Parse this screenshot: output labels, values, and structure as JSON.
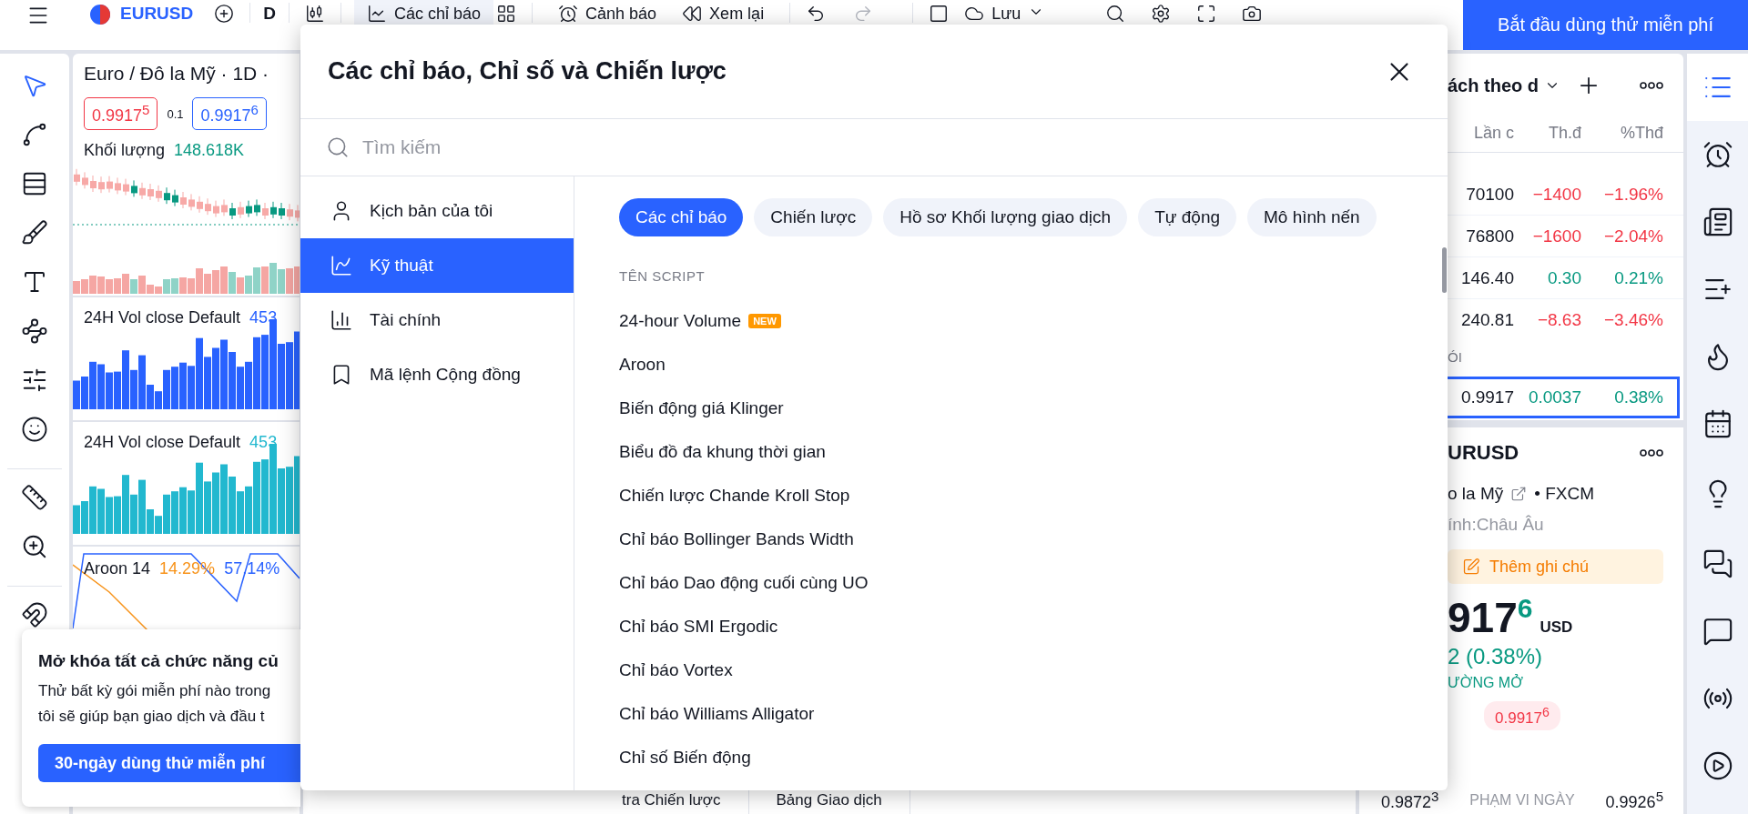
{
  "toolbar": {
    "symbol": "EURUSD",
    "interval": "D",
    "buttons": [
      {
        "kind": "indicators",
        "label": "Các chỉ báo",
        "selected": true
      },
      {
        "kind": "alert",
        "label": "Cảnh báo",
        "selected": false
      },
      {
        "kind": "replay",
        "label": "Xem lại",
        "selected": false
      }
    ],
    "redo_disabled": true,
    "save_label": "Lưu",
    "cta": "Bắt đầu dùng thử miễn phí"
  },
  "drawing_tools": [
    {
      "kind": "cursor",
      "selected": true
    },
    {
      "kind": "trend-line",
      "selected": false
    },
    {
      "kind": "fib",
      "selected": false
    },
    {
      "kind": "brush",
      "selected": false
    },
    {
      "kind": "text",
      "selected": false
    },
    {
      "kind": "pattern",
      "selected": false
    },
    {
      "kind": "forecast",
      "selected": false
    },
    {
      "kind": "emoji",
      "selected": false
    },
    {
      "kind": "ruler",
      "selected": false
    },
    {
      "kind": "zoom",
      "selected": false
    },
    {
      "kind": "magnet",
      "selected": false
    }
  ],
  "chart": {
    "title": "Euro / Đô la Mỹ · 1D ·",
    "bid": "0.9917$^{5}$",
    "spread": "0.1",
    "ask": "0.9917$^{6}$",
    "volume_label": "Khối lượng",
    "volume_value": "148.618K",
    "panes": [
      {
        "kind": "bars",
        "name": "24H Vol close Default",
        "value": "453",
        "color": "#2962ff"
      },
      {
        "kind": "bars",
        "name": "24H Vol close Default",
        "value": "453",
        "color": "#22b8cf"
      },
      {
        "kind": "aroon",
        "name": "Aroon 14",
        "values": [
          {
            "text": "14.29%",
            "color": "#f7931a"
          },
          {
            "text": "57.14%",
            "color": "#2962ff"
          }
        ]
      }
    ]
  },
  "promo": {
    "title": "Mở khóa tất cả chức năng củ",
    "lines": [
      "Thử bất kỳ gói miễn phí nào trong",
      "tôi sẽ giúp bạn giao dịch và đầu t"
    ],
    "button": "30-ngày dùng thử miễn phí"
  },
  "bottom_tabs": [
    "tra Chiến lược",
    "Bảng Giao dịch"
  ],
  "dialog": {
    "title": "Các chỉ báo, Chỉ số và Chiến lược",
    "search": {
      "placeholder": "Tìm kiếm"
    },
    "nav": [
      {
        "kind": "user",
        "label": "Kịch bản của tôi",
        "selected": false
      },
      {
        "kind": "technical",
        "label": "Kỹ thuật",
        "selected": true
      },
      {
        "kind": "financial",
        "label": "Tài chính",
        "selected": false
      },
      {
        "kind": "community",
        "label": "Mã lệnh Cộng đồng",
        "selected": false
      }
    ],
    "tabs": [
      {
        "label": "Các chỉ báo",
        "selected": true
      },
      {
        "label": "Chiến lược",
        "selected": false
      },
      {
        "label": "Hồ sơ Khối lượng giao dịch",
        "selected": false
      },
      {
        "label": "Tự động",
        "selected": false
      },
      {
        "label": "Mô hình nến",
        "selected": false
      }
    ],
    "list_heading": "TÊN SCRIPT",
    "scripts": [
      {
        "name": "24-hour Volume",
        "badge": "NEW"
      },
      {
        "name": "Aroon"
      },
      {
        "name": "Biến động giá Klinger"
      },
      {
        "name": "Biểu đồ đa khung thời gian"
      },
      {
        "name": "Chiến lược Chande Kroll Stop"
      },
      {
        "name": "Chỉ báo Bollinger Bands Width"
      },
      {
        "name": "Chỉ báo Dao động cuối cùng UO"
      },
      {
        "name": "Chỉ báo SMI Ergodic"
      },
      {
        "name": "Chỉ báo Vortex"
      },
      {
        "name": "Chỉ báo Williams Alligator"
      },
      {
        "name": "Chỉ số Biến động"
      }
    ]
  },
  "watchlist": {
    "title": "ách theo d",
    "columns": [
      "Lần c",
      "Th.đ",
      "%Thđ"
    ],
    "rows": [
      {
        "last": "70100",
        "change": "−1400",
        "change_pct": "−1.96%",
        "color": "#f23645",
        "selected": false
      },
      {
        "last": "76800",
        "change": "−1600",
        "change_pct": "−2.04%",
        "color": "#f23645",
        "selected": false
      },
      {
        "last": "146.40",
        "change": "0.30",
        "change_pct": "0.21%",
        "color": "#089981",
        "selected": false
      },
      {
        "last": "240.81",
        "change": "−8.63",
        "change_pct": "−3.46%",
        "color": "#f23645",
        "selected": false
      }
    ],
    "section": "ÓI",
    "current": {
      "last": "0.9917",
      "change": "0.0037",
      "change_pct": "0.38%",
      "color": "#089981",
      "selected": true
    }
  },
  "details": {
    "symbol": "URUSD",
    "description": "o la Mỹ",
    "exchange": "• FXCM",
    "category": "ính:Châu Âu",
    "note_button": "Thêm ghi chú",
    "price_main": "917",
    "price_last": "6",
    "currency": "USD",
    "change": "2 (0.38%)",
    "status": "ƯỜNG MỞ",
    "ask_pill": "0.9917$^{6}$",
    "range_low": "0.9872$^{3}$",
    "range_label": "PHẠM VI NGÀY",
    "range_high": "0.9926$^{5}$"
  },
  "right_bar": [
    {
      "kind": "watchlist",
      "selected": true
    },
    {
      "kind": "alarm",
      "selected": false
    },
    {
      "kind": "news",
      "selected": false
    },
    {
      "kind": "notes",
      "selected": false
    },
    {
      "kind": "hot",
      "selected": false
    },
    {
      "kind": "calendar",
      "selected": false
    },
    {
      "kind": "ideas",
      "selected": false
    },
    {
      "kind": "chats",
      "selected": false
    },
    {
      "kind": "chat",
      "selected": false
    },
    {
      "kind": "streams",
      "selected": false
    },
    {
      "kind": "play",
      "selected": false
    }
  ]
}
